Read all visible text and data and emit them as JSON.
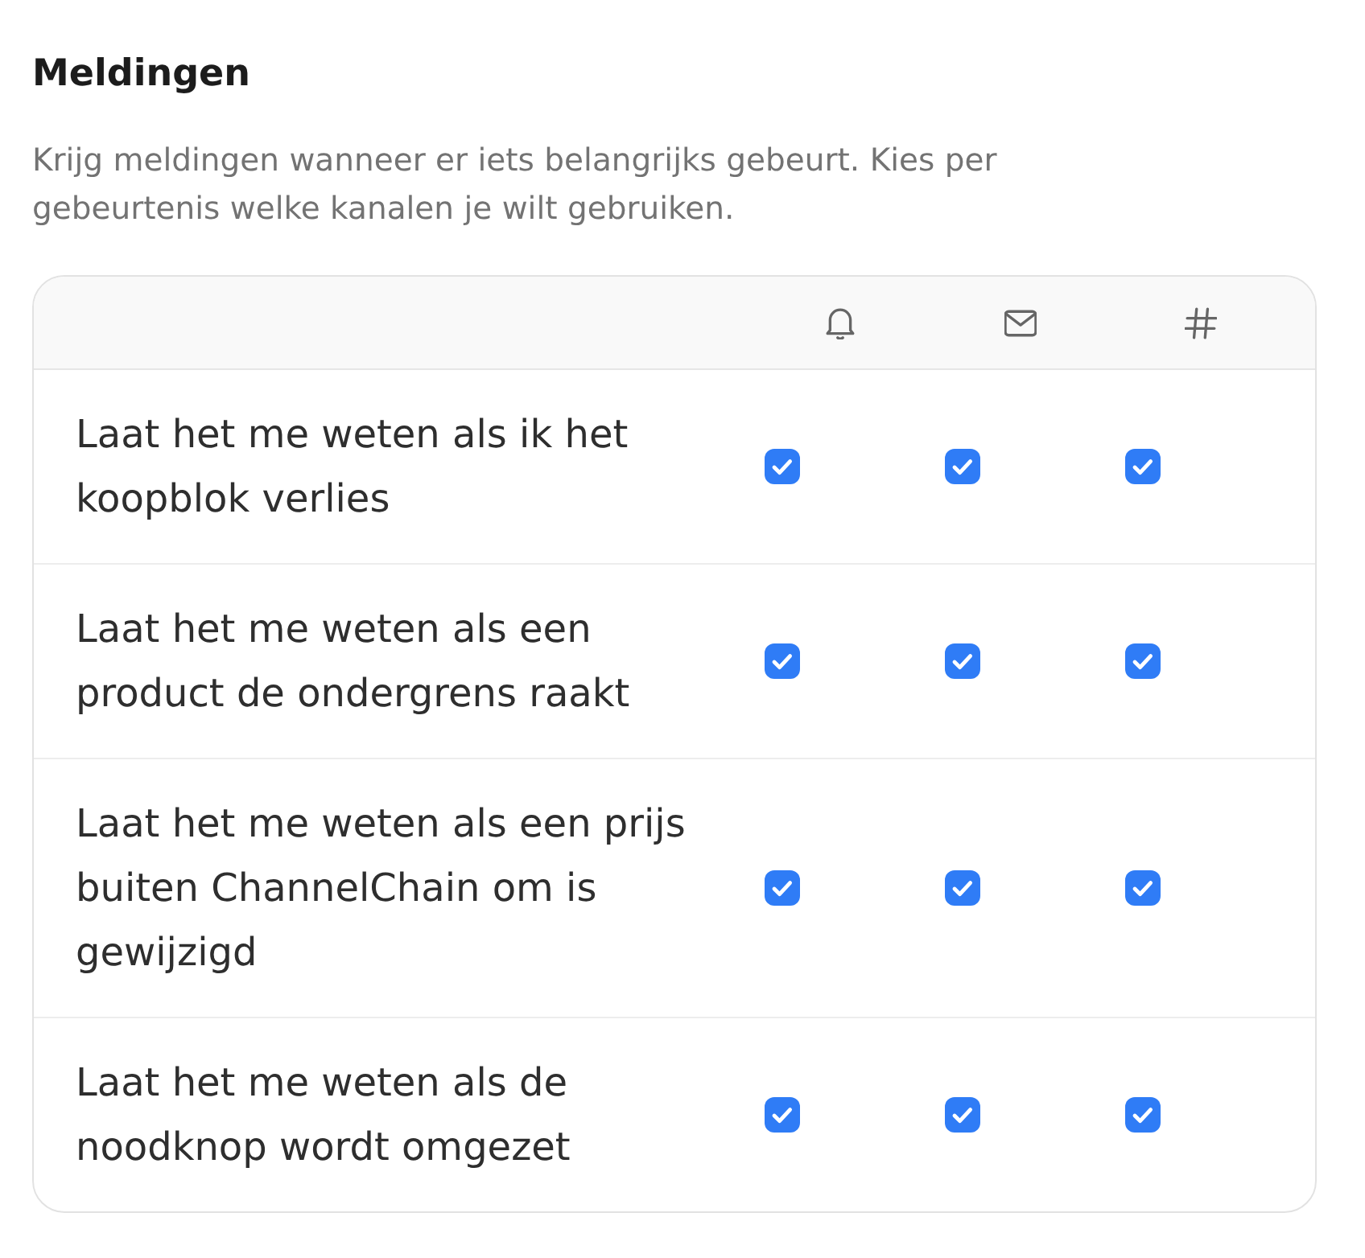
{
  "section": {
    "title": "Meldingen",
    "description": "Krijg meldingen wanneer er iets belangrijks gebeurt. Kies per gebeurtenis welke kanalen je wilt gebruiken."
  },
  "table": {
    "columns": [
      {
        "kind": "bell"
      },
      {
        "kind": "mail"
      },
      {
        "kind": "hash"
      }
    ],
    "rows": [
      {
        "label": "Laat het me weten als ik het koopblok verlies",
        "channels": [
          {
            "checked": true
          },
          {
            "checked": true
          },
          {
            "checked": true
          }
        ]
      },
      {
        "label": "Laat het me weten als een product de ondergrens raakt",
        "channels": [
          {
            "checked": true
          },
          {
            "checked": true
          },
          {
            "checked": true
          }
        ]
      },
      {
        "label": "Laat het me weten als een prijs buiten ChannelChain om is gewijzigd",
        "channels": [
          {
            "checked": true
          },
          {
            "checked": true
          },
          {
            "checked": true
          }
        ]
      },
      {
        "label": "Laat het me weten als de noodknop wordt omgezet",
        "channels": [
          {
            "checked": true
          },
          {
            "checked": true
          },
          {
            "checked": true
          }
        ]
      }
    ]
  }
}
